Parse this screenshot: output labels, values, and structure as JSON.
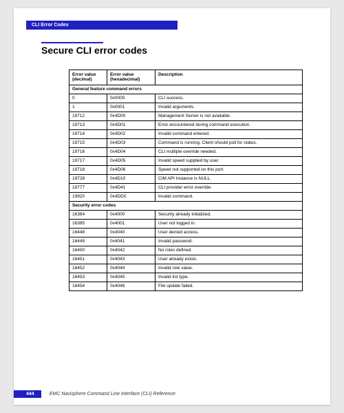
{
  "header": {
    "section": "CLI Error Codes"
  },
  "title": "Secure CLI error codes",
  "table": {
    "headers": {
      "decimal": "Error value\n(decimal)",
      "hex": "Error value\n(hexadecimal)",
      "desc": "Description"
    },
    "sections": [
      {
        "label": "General feature command errors",
        "rows": [
          {
            "dec": "0",
            "hex": "0x0000",
            "desc": "CLI success."
          },
          {
            "dec": "1",
            "hex": "0x0001",
            "desc": "Invalid arguments."
          },
          {
            "dec": "19712",
            "hex": "0x4D00",
            "desc": "Management Server is not available."
          },
          {
            "dec": "19713",
            "hex": "0x4D01",
            "desc": "Error encountered during command execution."
          },
          {
            "dec": "19714",
            "hex": "0x4D02",
            "desc": "Invalid command entered."
          },
          {
            "dec": "19715",
            "hex": "0x4D03",
            "desc": "Command is running. Client should poll for status."
          },
          {
            "dec": "19716",
            "hex": "0x4D04",
            "desc": "CLI multiple override needed."
          },
          {
            "dec": "19717",
            "hex": "0x4D05",
            "desc": "Invalid speed supplied by user."
          },
          {
            "dec": "19718",
            "hex": "0x4D06",
            "desc": "Speed not supported on this port."
          },
          {
            "dec": "19728",
            "hex": "0x4D10",
            "desc": "CIM API Instance is NULL."
          },
          {
            "dec": "19777",
            "hex": "0x4D41",
            "desc": "CLI provider error override."
          },
          {
            "dec": "19920",
            "hex": "0x4DD0",
            "desc": "Invalid command."
          }
        ]
      },
      {
        "label": "Security error codes",
        "rows": [
          {
            "dec": "16384",
            "hex": "0x4000",
            "desc": "Security already initialized."
          },
          {
            "dec": "16385",
            "hex": "0x4001",
            "desc": "User not logged in."
          },
          {
            "dec": "16448",
            "hex": "0x4040",
            "desc": "User denied access."
          },
          {
            "dec": "16449",
            "hex": "0x4041",
            "desc": "Invalid password."
          },
          {
            "dec": "16450",
            "hex": "0x4042",
            "desc": "No roles defined."
          },
          {
            "dec": "16451",
            "hex": "0x4043",
            "desc": "User already exists."
          },
          {
            "dec": "16452",
            "hex": "0x4044",
            "desc": "Invalid role value."
          },
          {
            "dec": "16453",
            "hex": "0x4045",
            "desc": "Invalid list type."
          },
          {
            "dec": "16454",
            "hex": "0x4046",
            "desc": "File update failed."
          }
        ]
      }
    ]
  },
  "footer": {
    "page": "444",
    "text": "EMC Navisphere Command Line Interface (CLI) Reference"
  }
}
